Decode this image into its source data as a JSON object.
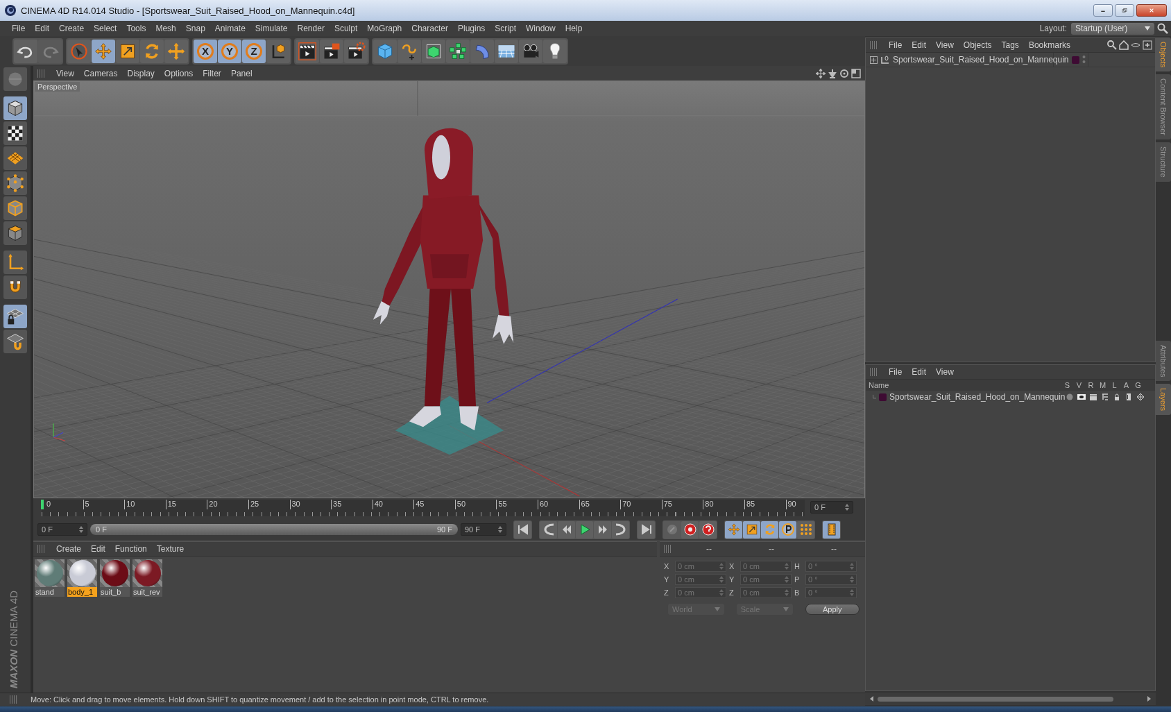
{
  "window": {
    "title": "CINEMA 4D R14.014 Studio - [Sportswear_Suit_Raised_Hood_on_Mannequin.c4d]"
  },
  "menu": [
    "File",
    "Edit",
    "Create",
    "Select",
    "Tools",
    "Mesh",
    "Snap",
    "Animate",
    "Simulate",
    "Render",
    "Sculpt",
    "MoGraph",
    "Character",
    "Plugins",
    "Script",
    "Window",
    "Help"
  ],
  "layout": {
    "label": "Layout:",
    "value": "Startup (User)"
  },
  "toolbar": [
    [
      {
        "kind": "undo",
        "selected": false,
        "disabled": false
      },
      {
        "kind": "redo",
        "selected": false,
        "disabled": true
      }
    ],
    [
      {
        "kind": "select",
        "selected": false,
        "disabled": false
      },
      {
        "kind": "move",
        "selected": true,
        "disabled": false
      },
      {
        "kind": "scale",
        "selected": false,
        "disabled": false
      },
      {
        "kind": "rotate",
        "selected": false,
        "disabled": false
      },
      {
        "kind": "live",
        "selected": false,
        "disabled": false
      }
    ],
    [
      {
        "kind": "axis",
        "label": "X",
        "selected": true,
        "disabled": false
      },
      {
        "kind": "axis",
        "label": "Y",
        "selected": true,
        "disabled": false
      },
      {
        "kind": "axis",
        "label": "Z",
        "selected": true,
        "disabled": false
      },
      {
        "kind": "coords",
        "selected": false,
        "disabled": false
      }
    ],
    [
      {
        "kind": "renderview",
        "selected": false,
        "disabled": false
      },
      {
        "kind": "renderpicture",
        "selected": false,
        "disabled": false
      },
      {
        "kind": "rendersettings",
        "selected": false,
        "disabled": false
      }
    ],
    [
      {
        "kind": "cube",
        "selected": false,
        "disabled": false
      },
      {
        "kind": "spline",
        "selected": false,
        "disabled": false
      },
      {
        "kind": "subdivision",
        "selected": false,
        "disabled": false
      },
      {
        "kind": "cloner",
        "selected": false,
        "disabled": false
      },
      {
        "kind": "deformer",
        "selected": false,
        "disabled": false
      },
      {
        "kind": "floor",
        "selected": false,
        "disabled": false
      },
      {
        "kind": "camera",
        "selected": false,
        "disabled": false
      },
      {
        "kind": "light",
        "selected": false,
        "disabled": false
      }
    ]
  ],
  "left_toolbar": [
    {
      "kind": "viewrotate",
      "selected": false
    },
    {
      "kind": "model",
      "selected": true
    },
    {
      "kind": "texture",
      "selected": false
    },
    {
      "kind": "workplane",
      "selected": false
    },
    {
      "kind": "points",
      "selected": false
    },
    {
      "kind": "edges",
      "selected": false
    },
    {
      "kind": "polygons",
      "selected": false
    },
    {
      "kind": "axistool",
      "selected": false
    },
    {
      "kind": "magnet",
      "selected": false
    },
    {
      "kind": "lockplane",
      "selected": true
    },
    {
      "kind": "snap",
      "selected": false
    }
  ],
  "viewport": {
    "menu": [
      "View",
      "Cameras",
      "Display",
      "Options",
      "Filter",
      "Panel"
    ],
    "camera_label": "Perspective"
  },
  "timeline": {
    "ticks": [
      "0",
      "5",
      "10",
      "15",
      "20",
      "25",
      "30",
      "35",
      "40",
      "45",
      "50",
      "55",
      "60",
      "65",
      "70",
      "75",
      "80",
      "85",
      "90"
    ],
    "level": 0,
    "current_frame": "0 F",
    "start": "0 F",
    "range": {
      "start": "0 F",
      "end": "90 F",
      "level": 1
    },
    "end": "90 F"
  },
  "playback": [
    [
      {
        "kind": "first",
        "selected": false,
        "disabled": false
      }
    ],
    [
      {
        "kind": "prevkey",
        "selected": false,
        "disabled": false
      },
      {
        "kind": "prevframe",
        "selected": false,
        "disabled": false
      },
      {
        "kind": "play",
        "selected": false,
        "disabled": false
      },
      {
        "kind": "nextframe",
        "selected": false,
        "disabled": false
      },
      {
        "kind": "nextkey",
        "selected": false,
        "disabled": false
      }
    ],
    [
      {
        "kind": "last",
        "selected": false,
        "disabled": false
      }
    ],
    [
      {
        "kind": "keyframe",
        "selected": false,
        "disabled": true
      },
      {
        "kind": "record",
        "selected": false,
        "disabled": false
      },
      {
        "kind": "autokey",
        "selected": false,
        "disabled": false
      }
    ],
    [
      {
        "kind": "move",
        "selected": true,
        "disabled": false
      },
      {
        "kind": "scale",
        "selected": true,
        "disabled": false
      },
      {
        "kind": "rotate",
        "selected": true,
        "disabled": false
      },
      {
        "kind": "param",
        "selected": true,
        "disabled": false
      },
      {
        "kind": "pla",
        "selected": false,
        "disabled": false
      }
    ],
    [
      {
        "kind": "timeline",
        "selected": true,
        "disabled": false
      }
    ]
  ],
  "materials": {
    "menu": [
      "Create",
      "Edit",
      "Function",
      "Texture"
    ],
    "items": [
      {
        "name": "stand",
        "selected": false,
        "color": "#5f7c77"
      },
      {
        "name": "body_1",
        "selected": true,
        "color": "#c9cbd6"
      },
      {
        "name": "suit_b",
        "selected": false,
        "color": "#6c0c16"
      },
      {
        "name": "suit_rev",
        "selected": false,
        "color": "#7c1a24"
      }
    ]
  },
  "coordinates": {
    "headers": [
      "--",
      "--",
      "--"
    ],
    "rows": [
      [
        {
          "axis": "X",
          "value": "0 cm"
        },
        {
          "axis": "X",
          "value": "0 cm"
        },
        {
          "axis": "H",
          "value": "0 °"
        }
      ],
      [
        {
          "axis": "Y",
          "value": "0 cm"
        },
        {
          "axis": "Y",
          "value": "0 cm"
        },
        {
          "axis": "P",
          "value": "0 °"
        }
      ],
      [
        {
          "axis": "Z",
          "value": "0 cm"
        },
        {
          "axis": "Z",
          "value": "0 cm"
        },
        {
          "axis": "B",
          "value": "0 °"
        }
      ]
    ],
    "dropdowns": [
      "World",
      "Scale"
    ],
    "apply": "Apply"
  },
  "objects": {
    "menu": [
      "File",
      "Edit",
      "View",
      "Objects",
      "Tags",
      "Bookmarks"
    ],
    "items": [
      {
        "name": "Sportswear_Suit_Raised_Hood_on_Mannequin",
        "color": "#3e0b33"
      }
    ]
  },
  "layers": {
    "menu": [
      "File",
      "Edit",
      "View"
    ],
    "columns": [
      "Name",
      "S",
      "V",
      "R",
      "M",
      "L",
      "A",
      "G"
    ],
    "items": [
      {
        "name": "Sportswear_Suit_Raised_Hood_on_Mannequin",
        "color": "#3e0b33"
      }
    ]
  },
  "side_tabs": {
    "top": [
      {
        "label": "Objects",
        "selected": true
      },
      {
        "label": "Content Browser",
        "selected": false
      },
      {
        "label": "Structure",
        "selected": false
      }
    ],
    "bottom": [
      {
        "label": "Attributes",
        "selected": false
      },
      {
        "label": "Layers",
        "selected": true
      }
    ]
  },
  "logo": {
    "brand": "MAXON",
    "product": "CINEMA 4D"
  },
  "status_bar": "Move: Click and drag to move elements. Hold down SHIFT to quantize movement / add to the selection in point mode, CTRL to remove."
}
